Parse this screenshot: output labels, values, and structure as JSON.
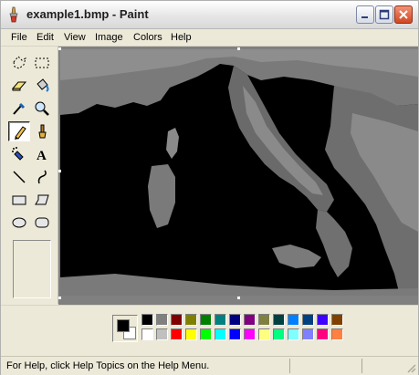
{
  "window": {
    "title": "example1.bmp - Paint"
  },
  "menu": {
    "items": [
      "File",
      "Edit",
      "View",
      "Image",
      "Colors",
      "Help"
    ]
  },
  "toolbox": {
    "tools": [
      "free-form-select-icon",
      "select-icon",
      "eraser-icon",
      "fill-with-color-icon",
      "pick-color-icon",
      "magnifier-icon",
      "pencil-icon",
      "brush-icon",
      "airbrush-icon",
      "text-icon",
      "line-icon",
      "curve-icon",
      "rectangle-icon",
      "polygon-icon",
      "ellipse-icon",
      "rounded-rectangle-icon"
    ],
    "active_tool": "pencil-icon",
    "text_tool_label": "A"
  },
  "colors": {
    "foreground": "#000000",
    "background": "#ffffff",
    "palette_top": [
      "#000000",
      "#808080",
      "#800000",
      "#808000",
      "#008000",
      "#008080",
      "#000080",
      "#800080",
      "#808040",
      "#004040",
      "#0080ff",
      "#004080",
      "#4000ff",
      "#804000"
    ],
    "palette_bottom": [
      "#ffffff",
      "#c0c0c0",
      "#ff0000",
      "#ffff00",
      "#00ff00",
      "#00ffff",
      "#0000ff",
      "#ff00ff",
      "#ffff80",
      "#00ff80",
      "#80ffff",
      "#8080ff",
      "#ff0080",
      "#ff8040"
    ]
  },
  "status": {
    "text": "For Help, click Help Topics on the Help Menu."
  }
}
